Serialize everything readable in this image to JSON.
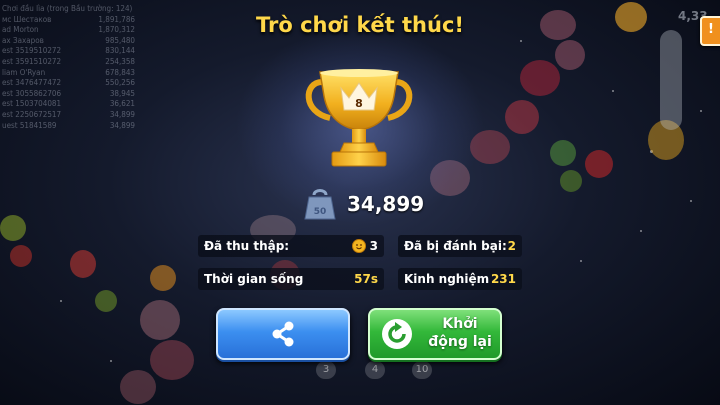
{
  "title": "Trò chơi kết thúc!",
  "trophy": {
    "rank": "8"
  },
  "weight_icon_label": "50",
  "score": "34,899",
  "stats": {
    "collected": {
      "label": "Đã thu thập:",
      "value": "3"
    },
    "defeated": {
      "label": "Đã bị đánh bại:",
      "value": "2"
    },
    "time_alive": {
      "label": "Thời gian sống",
      "value": "57s"
    },
    "experience": {
      "label": "Kinh nghiệm",
      "value": "231"
    }
  },
  "buttons": {
    "restart_label": "Khởi\nđộng lại"
  },
  "background": {
    "leaderboard": {
      "header": "Chơi đầu lìa (trong Bầu trường: 124)",
      "rows": [
        [
          "мс Шестаков",
          "1,891,786"
        ],
        [
          "ad Morton",
          "1,870,312"
        ],
        [
          "ах Захаров",
          "985,480"
        ],
        [
          "est 3519510272",
          "830,144"
        ],
        [
          "est 3591510272",
          "254,358"
        ],
        [
          "liam O'Ryan",
          "678,843"
        ],
        [
          "est 3476477472",
          "550,256"
        ],
        [
          "est 3055862706",
          "38,945"
        ],
        [
          "est 1503704081",
          "36,621"
        ],
        [
          "est 2250672517",
          "34,899"
        ],
        [
          "uest 51841589",
          "34,899"
        ]
      ]
    },
    "top_right_score": "4,33",
    "top_right_button": "!",
    "bottom_numbers": [
      "3",
      "4",
      "10"
    ]
  },
  "colors": {
    "title": "#ffd84a",
    "stat_value": "#ffd84a",
    "share_button": "#3c8ff0",
    "restart_button": "#33b83a"
  }
}
